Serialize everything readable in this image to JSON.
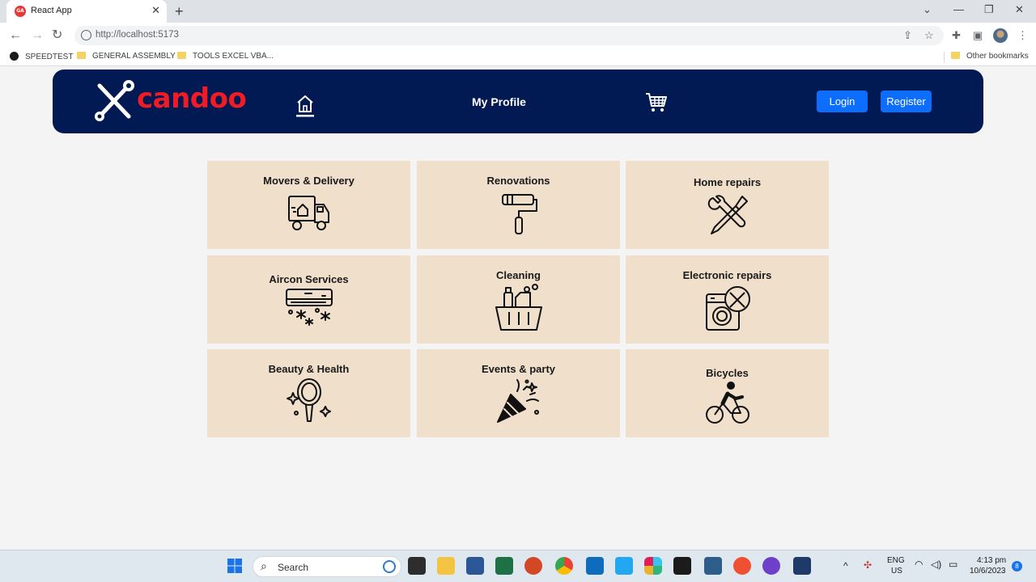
{
  "browser": {
    "tab_title": "React App",
    "tab_favicon_text": "GA",
    "url": "http://localhost:5173",
    "bookmarks": [
      "SPEEDTEST",
      "GENERAL ASSEMBLY",
      "TOOLS EXCEL VBA..."
    ],
    "other_bookmarks": "Other bookmarks"
  },
  "navbar": {
    "brand": "candoo",
    "profile_label": "My Profile",
    "login_label": "Login",
    "register_label": "Register",
    "colors": {
      "background": "#021a54",
      "brand": "#f01b24",
      "button": "#0d6efd"
    }
  },
  "services": [
    {
      "title": "Movers & Delivery",
      "icon": "truck-icon"
    },
    {
      "title": "Renovations",
      "icon": "paint-roller-icon"
    },
    {
      "title": "Home repairs",
      "icon": "tools-icon"
    },
    {
      "title": "Aircon Services",
      "icon": "air-conditioner-icon"
    },
    {
      "title": "Cleaning",
      "icon": "cleaning-basket-icon"
    },
    {
      "title": "Electronic repairs",
      "icon": "washing-machine-repair-icon"
    },
    {
      "title": "Beauty & Health",
      "icon": "hand-mirror-icon"
    },
    {
      "title": "Events & party",
      "icon": "party-popper-icon"
    },
    {
      "title": "Bicycles",
      "icon": "cyclist-icon"
    }
  ],
  "taskbar": {
    "search_placeholder": "Search",
    "lang": "ENG",
    "region": "US",
    "time": "4:13 pm",
    "date": "10/6/2023",
    "notifications": "8"
  }
}
